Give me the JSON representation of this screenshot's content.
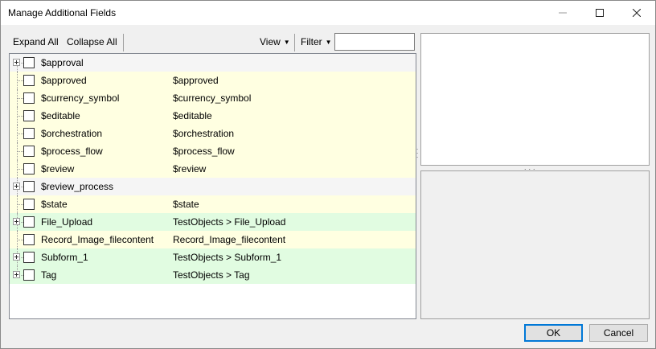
{
  "window": {
    "title": "Manage Additional Fields",
    "controls": {
      "minimize": "minimize-icon",
      "maximize": "maximize-icon",
      "close": "close-icon"
    }
  },
  "toolbar": {
    "expand_all": "Expand All",
    "collapse_all": "Collapse All",
    "view": "View",
    "filter": "Filter",
    "filter_value": ""
  },
  "colors": {
    "yellow_row": "#ffffe1",
    "green_row": "#e1fce1",
    "gray_row": "#f5f5f5",
    "white_row": "#ffffff"
  },
  "tree": {
    "rows": [
      {
        "name": "$approval",
        "path": "",
        "expandable": true,
        "tint": "gray"
      },
      {
        "name": "$approved",
        "path": "$approved",
        "expandable": false,
        "tint": "yellow"
      },
      {
        "name": "$currency_symbol",
        "path": "$currency_symbol",
        "expandable": false,
        "tint": "yellow"
      },
      {
        "name": "$editable",
        "path": "$editable",
        "expandable": false,
        "tint": "yellow"
      },
      {
        "name": "$orchestration",
        "path": "$orchestration",
        "expandable": false,
        "tint": "yellow"
      },
      {
        "name": "$process_flow",
        "path": "$process_flow",
        "expandable": false,
        "tint": "yellow"
      },
      {
        "name": "$review",
        "path": "$review",
        "expandable": false,
        "tint": "yellow"
      },
      {
        "name": "$review_process",
        "path": "",
        "expandable": true,
        "tint": "gray"
      },
      {
        "name": "$state",
        "path": "$state",
        "expandable": false,
        "tint": "yellow"
      },
      {
        "name": "File_Upload",
        "path": "TestObjects > File_Upload",
        "expandable": true,
        "tint": "green"
      },
      {
        "name": "Record_Image_filecontent",
        "path": "Record_Image_filecontent",
        "expandable": false,
        "tint": "yellow"
      },
      {
        "name": "Subform_1",
        "path": "TestObjects > Subform_1",
        "expandable": true,
        "tint": "green"
      },
      {
        "name": "Tag",
        "path": "TestObjects > Tag",
        "expandable": true,
        "tint": "green"
      }
    ]
  },
  "buttons": {
    "ok": "OK",
    "cancel": "Cancel"
  }
}
